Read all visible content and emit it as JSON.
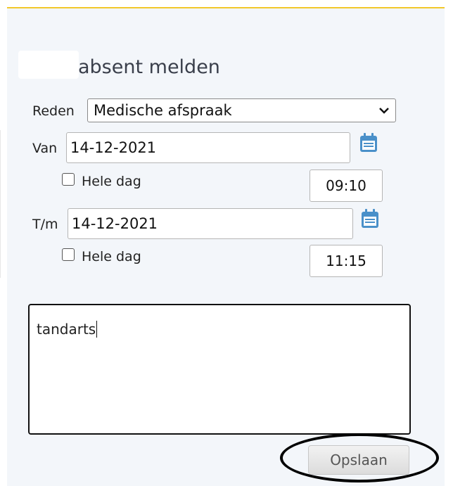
{
  "form": {
    "title": "absent melden",
    "reason_label": "Reden",
    "reason_value": "Medische afspraak",
    "from_label": "Van",
    "from_date": "14-12-2021",
    "from_allday_label": "Hele dag",
    "from_allday_checked": false,
    "from_time": "09:10",
    "to_label": "T/m",
    "to_date": "14-12-2021",
    "to_allday_label": "Hele dag",
    "to_allday_checked": false,
    "to_time": "11:15",
    "note_text": "tandarts",
    "save_label": "Opslaan"
  },
  "icons": {
    "reason_dropdown": "chevron-down-icon",
    "from_calendar": "calendar-icon",
    "to_calendar": "calendar-icon"
  },
  "colors": {
    "accent_top_border": "#f2c82b",
    "panel_background": "#f3f6fa",
    "calendar_icon": "#4a90c9"
  }
}
